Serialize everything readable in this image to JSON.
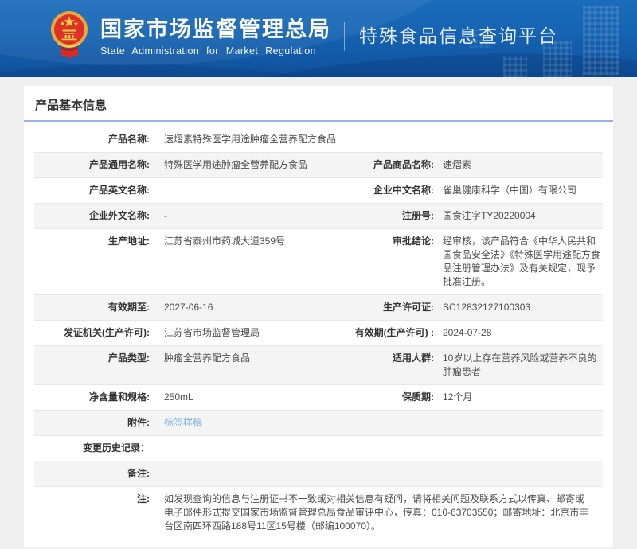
{
  "header": {
    "org_name_cn": "国家市场监督管理总局",
    "org_name_en": "State Administration for Market Regulation",
    "platform_name": "特殊食品信息查询平台",
    "emblem_icon": "china-national-emblem",
    "colors": {
      "banner_blue": "#1563b2",
      "accent_line": "#9db1e8",
      "link_blue": "#74aee6"
    }
  },
  "section": {
    "title": "产品基本信息"
  },
  "table": {
    "rows": [
      {
        "type": "single",
        "cells": [
          {
            "label": "产品名称:",
            "value": "速熠素特殊医学用途肿瘤全营养配方食品"
          }
        ]
      },
      {
        "type": "double",
        "cells": [
          {
            "label": "产品通用名称:",
            "value": "特殊医学用途肿瘤全营养配方食品"
          },
          {
            "label": "产品商品名称:",
            "value": "速熠素"
          }
        ]
      },
      {
        "type": "double",
        "cells": [
          {
            "label": "产品英文名称:",
            "value": ""
          },
          {
            "label": "企业中文名称:",
            "value": "雀巢健康科学（中国）有限公司"
          }
        ]
      },
      {
        "type": "double",
        "cells": [
          {
            "label": "企业外文名称:",
            "value": "-"
          },
          {
            "label": "注册号:",
            "value": "国食注字TY20220004"
          }
        ]
      },
      {
        "type": "double",
        "cells": [
          {
            "label": "生产地址:",
            "value": "江苏省泰州市药城大道359号"
          },
          {
            "label": "审批结论:",
            "value": "经审核，该产品符合《中华人民共和国食品安全法》《特殊医学用途配方食品注册管理办法》及有关规定，现予批准注册。"
          }
        ]
      },
      {
        "type": "double",
        "cells": [
          {
            "label": "有效期至:",
            "value": "2027-06-16"
          },
          {
            "label": "生产许可证:",
            "value": "SC12832127100303"
          }
        ]
      },
      {
        "type": "double",
        "cells": [
          {
            "label": "发证机关(生产许可):",
            "value": "江苏省市场监督管理局"
          },
          {
            "label": "有效期(生产许可) :",
            "value": "2024-07-28"
          }
        ]
      },
      {
        "type": "double",
        "cells": [
          {
            "label": "产品类型:",
            "value": "肿瘤全营养配方食品"
          },
          {
            "label": "适用人群:",
            "value": "10岁以上存在营养风险或营养不良的肿瘤患者"
          }
        ]
      },
      {
        "type": "double",
        "cells": [
          {
            "label": "净含量和规格:",
            "value": "250mL"
          },
          {
            "label": "保质期:",
            "value": "12个月"
          }
        ]
      },
      {
        "type": "single",
        "cells": [
          {
            "label": "附件:",
            "value": "标签样稿",
            "link": true
          }
        ]
      },
      {
        "type": "single",
        "cells": [
          {
            "label": "变更历史记录：",
            "value": ""
          }
        ]
      },
      {
        "type": "single",
        "cells": [
          {
            "label": "备注:",
            "value": ""
          }
        ]
      },
      {
        "type": "single",
        "cells": [
          {
            "label": "注:",
            "value": "如发现查询的信息与注册证书不一致或对相关信息有疑问，请将相关问题及联系方式以传真、邮寄或电子邮件形式提交国家市场监督管理总局食品审评中心，传真：010-63703550；邮寄地址：北京市丰台区南四环西路188号11区15号楼（邮编100070）。"
          }
        ]
      }
    ]
  }
}
